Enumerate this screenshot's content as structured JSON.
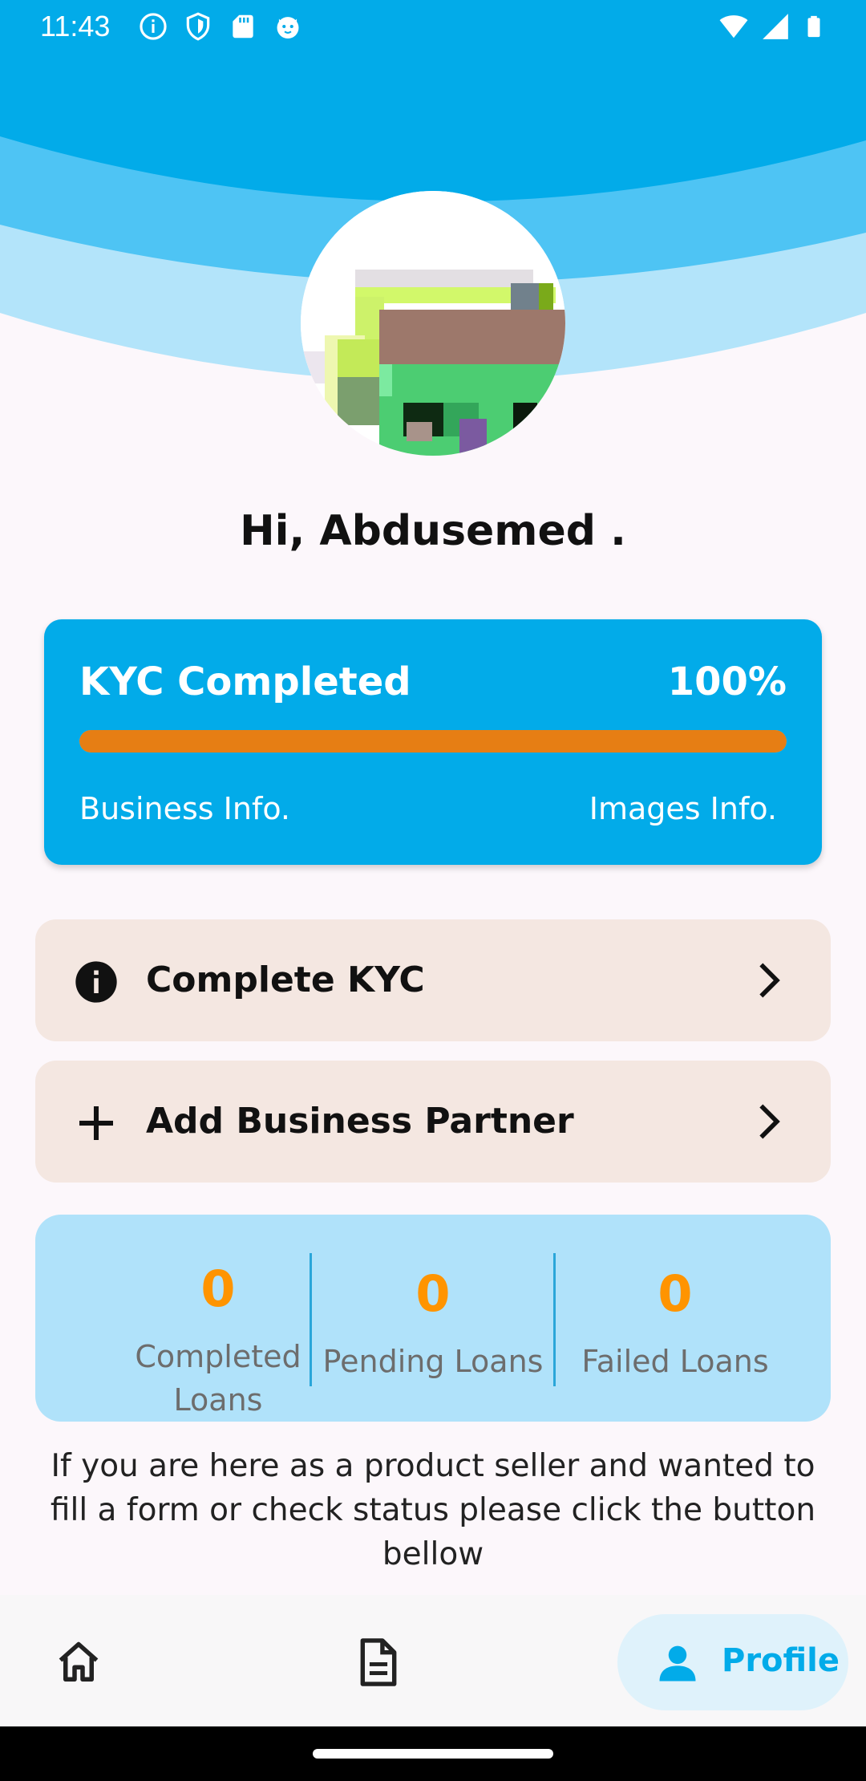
{
  "status_bar": {
    "time": "11:43",
    "left_icons": [
      "info-icon",
      "shield-icon",
      "sd-card-icon",
      "cat-face-icon"
    ],
    "right_icons": [
      "wifi-icon",
      "cell-signal-icon",
      "battery-icon"
    ]
  },
  "colors": {
    "primary": "#02abe9",
    "progress": "#e67e14",
    "stat_value": "#ff9400",
    "action_row_bg": "#f4e7e1",
    "stats_bg": "#b0e2fa"
  },
  "profile": {
    "greeting": "Hi, Abdusemed ."
  },
  "kyc": {
    "title": "KYC Completed",
    "percent_label": "100%",
    "progress": 1.0,
    "step_left": "Business Info.",
    "step_right": "Images Info."
  },
  "actions": [
    {
      "label": "Complete KYC",
      "icon": "info-icon"
    },
    {
      "label": "Add Business Partner",
      "icon": "plus-icon"
    }
  ],
  "stats": [
    {
      "value": "0",
      "label": "Completed Loans"
    },
    {
      "value": "0",
      "label": "Pending Loans"
    },
    {
      "value": "0",
      "label": "Failed Loans"
    }
  ],
  "info_text": "If you are here as a product seller and wanted to fill a form or check status please click the button bellow",
  "bottom_nav": {
    "items": [
      {
        "icon": "home-icon"
      },
      {
        "icon": "document-icon"
      },
      {
        "icon": "person-icon",
        "label": "Profile",
        "active": true
      }
    ]
  }
}
